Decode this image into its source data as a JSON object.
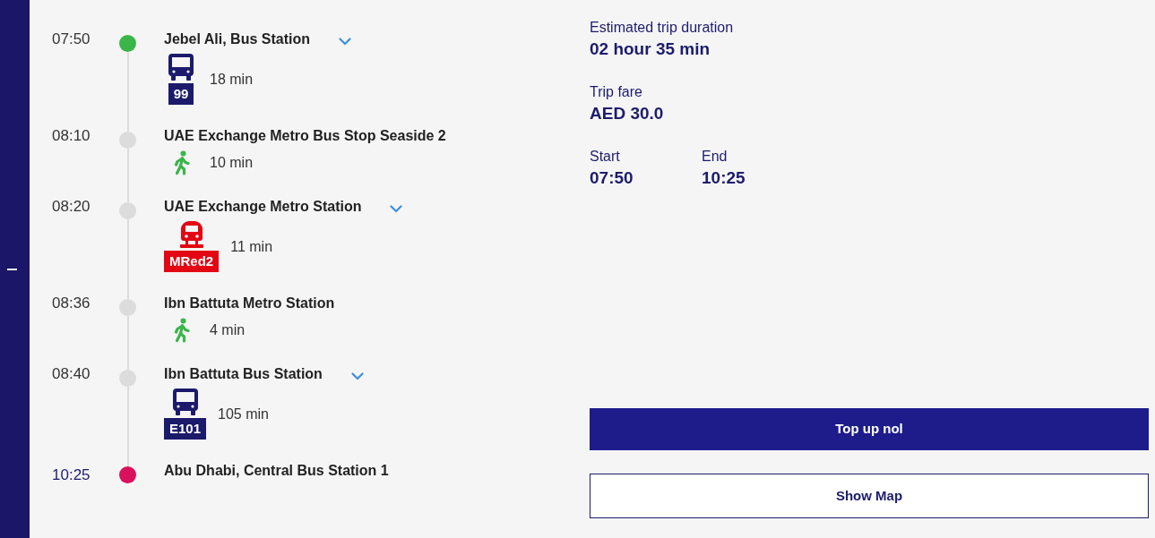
{
  "itinerary": [
    {
      "kind": "origin",
      "time": "07:50",
      "name": "Jebel Ali, Bus Station",
      "expanded": false,
      "leg": {
        "kind": "bus",
        "route": "99",
        "duration": "18 min"
      }
    },
    {
      "kind": "transfer",
      "time": "08:10",
      "name": "UAE Exchange Metro Bus Stop Seaside 2",
      "leg": {
        "kind": "walk",
        "duration": "10 min"
      }
    },
    {
      "kind": "transfer",
      "time": "08:20",
      "name": "UAE Exchange Metro Station",
      "expanded": false,
      "leg": {
        "kind": "metro",
        "route": "MRed2",
        "duration": "11 min"
      }
    },
    {
      "kind": "transfer",
      "time": "08:36",
      "name": "Ibn Battuta Metro Station",
      "leg": {
        "kind": "walk",
        "duration": "4 min"
      }
    },
    {
      "kind": "transfer",
      "time": "08:40",
      "name": "Ibn Battuta Bus Station",
      "expanded": false,
      "leg": {
        "kind": "bus",
        "route": "E101",
        "duration": "105 min"
      }
    },
    {
      "kind": "destination",
      "time": "10:25",
      "name": "Abu Dhabi, Central Bus Station 1"
    }
  ],
  "summary": {
    "duration": {
      "label": "Estimated trip duration",
      "value": "02 hour 35 min"
    },
    "fare": {
      "label": "Trip fare",
      "value": "AED 30.0"
    },
    "times": [
      {
        "label": "Start",
        "value": "07:50"
      },
      {
        "label": "End",
        "value": "10:25"
      }
    ]
  },
  "top_up_button": {
    "label": "Top up nol"
  },
  "map_button": {
    "label": "Show Map"
  }
}
